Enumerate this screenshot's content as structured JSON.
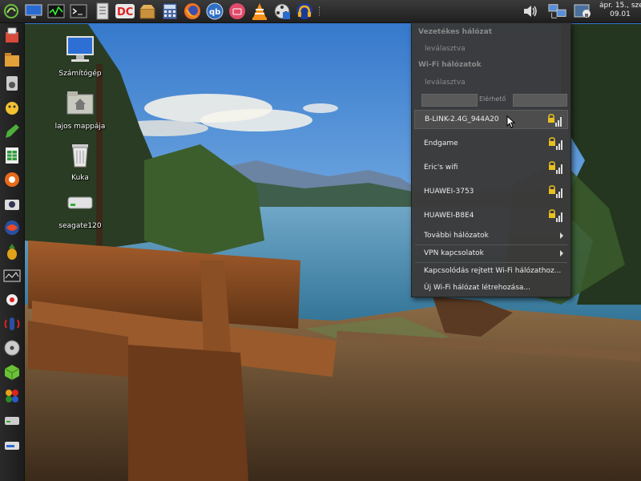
{
  "top_panel": {
    "launchers": [
      {
        "icon": "menu-swirl-icon"
      },
      {
        "icon": "monitor-icon"
      },
      {
        "icon": "system-monitor-icon"
      },
      {
        "icon": "terminal-icon"
      },
      {
        "icon": "text-editor-icon"
      },
      {
        "icon": "double-commander-icon"
      },
      {
        "icon": "archive-manager-icon"
      },
      {
        "icon": "calculator-icon"
      },
      {
        "icon": "firefox-icon"
      },
      {
        "icon": "qbittorrent-icon"
      },
      {
        "icon": "screenshot-icon"
      },
      {
        "icon": "vlc-icon"
      },
      {
        "icon": "video-editor-icon"
      },
      {
        "icon": "audio-player-icon"
      }
    ],
    "tray": [
      {
        "icon": "volume-icon"
      },
      {
        "icon": "network-icon"
      },
      {
        "icon": "user-icon"
      }
    ],
    "clock": {
      "date": "ápr. 15., sze",
      "time": "09.01"
    }
  },
  "dock": {
    "items": [
      {
        "icon": "software-center-icon"
      },
      {
        "icon": "file-manager-icon"
      },
      {
        "icon": "music-icon"
      },
      {
        "icon": "messenger-icon"
      },
      {
        "icon": "notes-icon"
      },
      {
        "icon": "spreadsheet-icon"
      },
      {
        "icon": "ubuntu-tweak-icon"
      },
      {
        "icon": "camera-icon"
      },
      {
        "icon": "browser-globe-icon"
      },
      {
        "icon": "pineapple-icon"
      },
      {
        "icon": "video-icon"
      },
      {
        "icon": "media-icon"
      },
      {
        "icon": "audio-icon"
      },
      {
        "icon": "disc-icon"
      },
      {
        "icon": "cube-icon"
      },
      {
        "icon": "apps-icon"
      },
      {
        "icon": "drive-icon"
      },
      {
        "icon": "disk-utility-icon"
      }
    ]
  },
  "desktop": {
    "icons": [
      {
        "label": "Számítógép",
        "icon": "computer-icon"
      },
      {
        "label": "lajos mappája",
        "icon": "home-folder-icon"
      },
      {
        "label": "Kuka",
        "icon": "trash-icon"
      },
      {
        "label": "seagate120",
        "icon": "hard-drive-icon"
      }
    ]
  },
  "network_menu": {
    "wired_header": "Vezetékes hálózat",
    "wired_status": "leválasztva",
    "wifi_header": "Wi-Fi hálózatok",
    "wifi_status": "leválasztva",
    "filter_label": "Elérhető",
    "networks": [
      {
        "name": "B-LINK-2.4G_944A20",
        "secured": true,
        "highlighted": true
      },
      {
        "name": "Endgame",
        "secured": true
      },
      {
        "name": "Eric's wifi",
        "secured": true
      },
      {
        "name": "HUAWEI-3753",
        "secured": true
      },
      {
        "name": "HUAWEI-B8E4",
        "secured": true
      }
    ],
    "more_networks": "További hálózatok",
    "vpn": "VPN kapcsolatok",
    "connect_hidden": "Kapcsolódás rejtett Wi-Fi hálózathoz...",
    "create_new": "Új Wi-Fi hálózat létrehozása...",
    "colors": {
      "background": "#3a3a3a",
      "text": "#ececec",
      "disabled": "#8a8a8a",
      "lock": "#e8c020"
    }
  }
}
